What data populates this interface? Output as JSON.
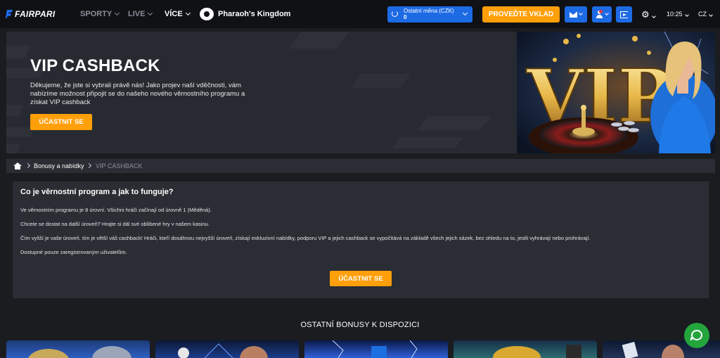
{
  "header": {
    "logo_text": "FAIRPARI",
    "nav": [
      "SPORTY",
      "LIVE",
      "VÍCE"
    ],
    "game_name": "Pharaoh's Kingdom",
    "wallet": {
      "label": "Ostatní měna (CZK)",
      "amount": "0"
    },
    "deposit_label": "PROVEĎTE VKLAD",
    "time": "10:25",
    "language": "CZ",
    "icons": [
      "mail-icon",
      "user-icon",
      "logout-icon",
      "gear-icon"
    ],
    "accent_color": "#1d6ae5",
    "cta_color": "#ff9f0a"
  },
  "banner": {
    "title": "VIP CASHBACK",
    "text": "Děkujeme, že jste si vybrali právě nás! Jako projev naší vděčnosti, vám nabízíme možnost připojit se do našeho nového věrnostního programu a získat VIP cashback",
    "button": "ÚČASTNIT SE",
    "art_text": "VIP"
  },
  "breadcrumb": {
    "items": [
      "Bonusy a nabídky",
      "VIP CASHBACK"
    ]
  },
  "info": {
    "title": "Co je věrnostní program a jak to funguje?",
    "lines": [
      "Ve věrnostním programu je 8 úrovní. Všichni hráči začínají od úrovně 1 (Měděná).",
      "Chcete se dostat na další úroveň? Hrajte si dál své oblíbené hry v našem kasinu.",
      "Čím vyšší je vaše úroveň, tím je větší váš cashback! Hráči, kteří dosáhnou nejvyšší úroveň, získají exkluzivní nabídky, podporu VIP a jejich cashback se vypočítává na základě všech jejich sázek, bez ohledu na to, jestli vyhrávají nebo prohrávají.",
      "Dostupné pouze zaregistrovaným uživatelům."
    ],
    "button": "ÚČASTNIT SE"
  },
  "other_bonuses": {
    "title": "OSTATNÍ BONUSY K DISPOZICI"
  },
  "chat": {
    "icon": "chat-icon",
    "color": "#24a53c"
  }
}
